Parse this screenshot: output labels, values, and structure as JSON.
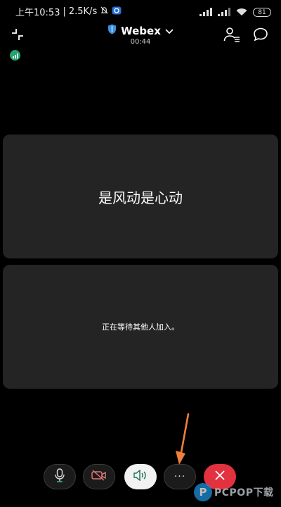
{
  "status_bar": {
    "time": "上午10:53",
    "separator": "|",
    "speed": "2.5K/s",
    "battery": "81"
  },
  "header": {
    "title": "Webex",
    "timer": "00:44"
  },
  "tiles": {
    "participant_name": "是风动是心动",
    "waiting_message": "正在等待其他人加入。"
  },
  "controls": {
    "more_label": "···"
  },
  "watermark": {
    "logo": "P",
    "text": "PCPOP下载"
  },
  "colors": {
    "background": "#000000",
    "tile": "#242424",
    "end_call": "#e2323f",
    "shield": "#3d8fe0",
    "signal": "#25a36d",
    "video_off": "#e07b7b",
    "annotation_arrow": "#f07f3c"
  },
  "icons": [
    "minimize-icon",
    "shield-icon",
    "chevron-down-icon",
    "participants-icon",
    "chat-icon",
    "signal-icon",
    "mic-icon",
    "video-off-icon",
    "speaker-icon",
    "more-icon",
    "close-icon",
    "arrow-icon"
  ]
}
